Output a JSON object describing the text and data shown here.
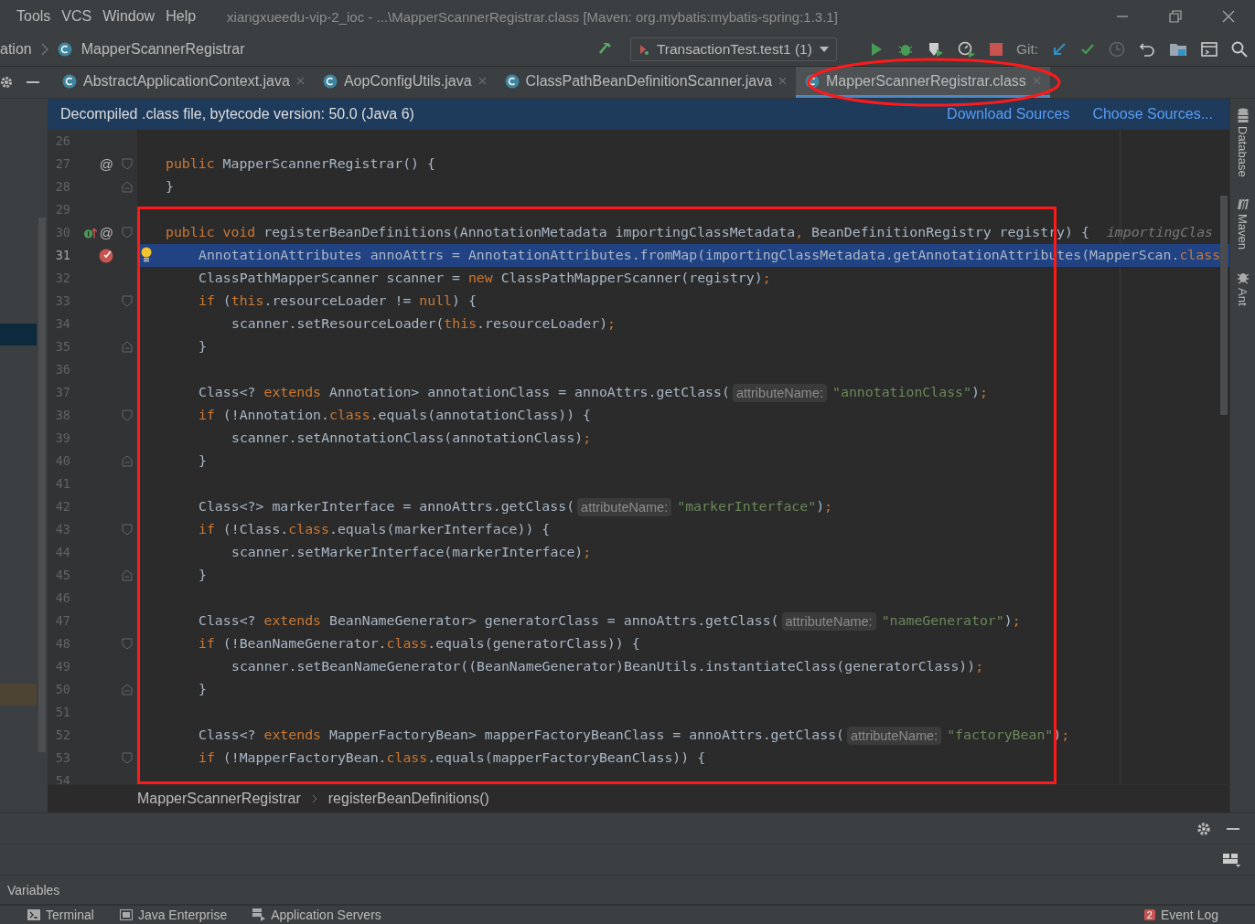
{
  "menu": [
    {
      "label": "Tools"
    },
    {
      "label": "VCS"
    },
    {
      "label": "Window"
    },
    {
      "label": "Help"
    }
  ],
  "window": {
    "title": "xiangxueedu-vip-2_ioc - ...\\MapperScannerRegistrar.class [Maven: org.mybatis:mybatis-spring:1.3.1]"
  },
  "navigation": {
    "crumbs": [
      "ation",
      "MapperScannerRegistrar"
    ],
    "run_config": "TransactionTest.test1 (1)",
    "git_label": "Git:"
  },
  "tabs": [
    {
      "label": "AbstractApplicationContext.java",
      "selected": false
    },
    {
      "label": "AopConfigUtils.java",
      "selected": false
    },
    {
      "label": "ClassPathBeanDefinitionScanner.java",
      "selected": false
    },
    {
      "label": "MapperScannerRegistrar.class",
      "selected": true
    }
  ],
  "banner": {
    "text": "Decompiled .class file, bytecode version: 50.0 (Java 6)",
    "links": [
      "Download Sources",
      "Choose Sources..."
    ]
  },
  "lines": [
    {
      "num": "26",
      "selected": false,
      "kind": "member"
    },
    {
      "num": "27",
      "selected": false,
      "kind": "member",
      "gutter": [
        {
          "kind": "at",
          "text": "@"
        },
        {
          "kind": "fold_start"
        }
      ],
      "tokens": [
        {
          "t": "public",
          "kind": "keyword"
        },
        {
          "t": " MapperScannerRegistrar() {",
          "kind": "plain"
        }
      ]
    },
    {
      "num": "28",
      "selected": false,
      "kind": "member",
      "gutter": [
        {
          "kind": "fold_end"
        }
      ],
      "tokens": [
        {
          "t": "}",
          "kind": "plain"
        }
      ]
    },
    {
      "num": "29",
      "selected": false,
      "kind": "member"
    },
    {
      "num": "30",
      "selected": false,
      "kind": "member",
      "gutter": [
        {
          "kind": "override"
        },
        {
          "kind": "at",
          "text": "@"
        },
        {
          "kind": "fold_start"
        }
      ],
      "tokens": [
        {
          "t": "public void",
          "kind": "keyword"
        },
        {
          "t": " registerBeanDefinitions(AnnotationMetadata importingClassMetadata",
          "kind": "plain"
        },
        {
          "t": ",",
          "kind": "keyword"
        },
        {
          "t": " BeanDefinitionRegistry registry) {",
          "kind": "plain"
        },
        {
          "t": "importingClas",
          "kind": "inlay"
        }
      ]
    },
    {
      "num": "31",
      "selected": true,
      "kind": "statement",
      "bulb": true,
      "gutter": [
        {
          "kind": "breakpoint"
        }
      ],
      "tokens": [
        {
          "t": "AnnotationAttributes annoAttrs = AnnotationAttributes.fromMap(importingClassMetadata.getAnnotationAttributes(MapperScan.",
          "kind": "plain"
        },
        {
          "t": "class",
          "kind": "keyword"
        }
      ]
    },
    {
      "num": "32",
      "selected": false,
      "kind": "statement",
      "tokens": [
        {
          "t": "ClassPathMapperScanner scanner = ",
          "kind": "plain"
        },
        {
          "t": "new",
          "kind": "keyword"
        },
        {
          "t": " ClassPathMapperScanner(registry)",
          "kind": "plain"
        },
        {
          "t": ";",
          "kind": "keyword"
        }
      ]
    },
    {
      "num": "33",
      "selected": false,
      "kind": "statement",
      "gutter": [
        {
          "kind": "fold_start"
        }
      ],
      "tokens": [
        {
          "t": "if",
          "kind": "keyword"
        },
        {
          "t": " (",
          "kind": "plain"
        },
        {
          "t": "this",
          "kind": "keyword"
        },
        {
          "t": ".resourceLoader != ",
          "kind": "plain"
        },
        {
          "t": "null",
          "kind": "keyword"
        },
        {
          "t": ") {",
          "kind": "plain"
        }
      ]
    },
    {
      "num": "34",
      "selected": false,
      "kind": "nested",
      "tokens": [
        {
          "t": "scanner.setResourceLoader(",
          "kind": "plain"
        },
        {
          "t": "this",
          "kind": "keyword"
        },
        {
          "t": ".resourceLoader)",
          "kind": "plain"
        },
        {
          "t": ";",
          "kind": "keyword"
        }
      ]
    },
    {
      "num": "35",
      "selected": false,
      "kind": "statement",
      "gutter": [
        {
          "kind": "fold_end"
        }
      ],
      "tokens": [
        {
          "t": "}",
          "kind": "plain"
        }
      ]
    },
    {
      "num": "36",
      "selected": false,
      "kind": "statement"
    },
    {
      "num": "37",
      "selected": false,
      "kind": "statement",
      "tokens": [
        {
          "t": "Class<? ",
          "kind": "plain"
        },
        {
          "t": "extends",
          "kind": "keyword"
        },
        {
          "t": " Annotation> annotationClass = annoAttrs.getClass(",
          "kind": "plain"
        },
        {
          "t": "attributeName:",
          "kind": "param"
        },
        {
          "t": "\"annotationClass\"",
          "kind": "string"
        },
        {
          "t": ")",
          "kind": "plain"
        },
        {
          "t": ";",
          "kind": "keyword"
        }
      ]
    },
    {
      "num": "38",
      "selected": false,
      "kind": "statement",
      "gutter": [
        {
          "kind": "fold_start"
        }
      ],
      "tokens": [
        {
          "t": "if",
          "kind": "keyword"
        },
        {
          "t": " (!Annotation.",
          "kind": "plain"
        },
        {
          "t": "class",
          "kind": "keyword"
        },
        {
          "t": ".equals(annotationClass)) {",
          "kind": "plain"
        }
      ]
    },
    {
      "num": "39",
      "selected": false,
      "kind": "nested",
      "tokens": [
        {
          "t": "scanner.setAnnotationClass(annotationClass)",
          "kind": "plain"
        },
        {
          "t": ";",
          "kind": "keyword"
        }
      ]
    },
    {
      "num": "40",
      "selected": false,
      "kind": "statement",
      "gutter": [
        {
          "kind": "fold_end"
        }
      ],
      "tokens": [
        {
          "t": "}",
          "kind": "plain"
        }
      ]
    },
    {
      "num": "41",
      "selected": false,
      "kind": "statement"
    },
    {
      "num": "42",
      "selected": false,
      "kind": "statement",
      "tokens": [
        {
          "t": "Class<?> markerInterface = annoAttrs.getClass(",
          "kind": "plain"
        },
        {
          "t": "attributeName:",
          "kind": "param"
        },
        {
          "t": "\"markerInterface\"",
          "kind": "string"
        },
        {
          "t": ")",
          "kind": "plain"
        },
        {
          "t": ";",
          "kind": "keyword"
        }
      ]
    },
    {
      "num": "43",
      "selected": false,
      "kind": "statement",
      "gutter": [
        {
          "kind": "fold_start"
        }
      ],
      "tokens": [
        {
          "t": "if",
          "kind": "keyword"
        },
        {
          "t": " (!Class.",
          "kind": "plain"
        },
        {
          "t": "class",
          "kind": "keyword"
        },
        {
          "t": ".equals(markerInterface)) {",
          "kind": "plain"
        }
      ]
    },
    {
      "num": "44",
      "selected": false,
      "kind": "nested",
      "tokens": [
        {
          "t": "scanner.setMarkerInterface(markerInterface)",
          "kind": "plain"
        },
        {
          "t": ";",
          "kind": "keyword"
        }
      ]
    },
    {
      "num": "45",
      "selected": false,
      "kind": "statement",
      "gutter": [
        {
          "kind": "fold_end"
        }
      ],
      "tokens": [
        {
          "t": "}",
          "kind": "plain"
        }
      ]
    },
    {
      "num": "46",
      "selected": false,
      "kind": "statement"
    },
    {
      "num": "47",
      "selected": false,
      "kind": "statement",
      "tokens": [
        {
          "t": "Class<? ",
          "kind": "plain"
        },
        {
          "t": "extends",
          "kind": "keyword"
        },
        {
          "t": " BeanNameGenerator> generatorClass = annoAttrs.getClass(",
          "kind": "plain"
        },
        {
          "t": "attributeName:",
          "kind": "param"
        },
        {
          "t": "\"nameGenerator\"",
          "kind": "string"
        },
        {
          "t": ")",
          "kind": "plain"
        },
        {
          "t": ";",
          "kind": "keyword"
        }
      ]
    },
    {
      "num": "48",
      "selected": false,
      "kind": "statement",
      "gutter": [
        {
          "kind": "fold_start"
        }
      ],
      "tokens": [
        {
          "t": "if",
          "kind": "keyword"
        },
        {
          "t": " (!BeanNameGenerator.",
          "kind": "plain"
        },
        {
          "t": "class",
          "kind": "keyword"
        },
        {
          "t": ".equals(generatorClass)) {",
          "kind": "plain"
        }
      ]
    },
    {
      "num": "49",
      "selected": false,
      "kind": "nested",
      "tokens": [
        {
          "t": "scanner.setBeanNameGenerator((BeanNameGenerator)BeanUtils.instantiateClass(generatorClass))",
          "kind": "plain"
        },
        {
          "t": ";",
          "kind": "keyword"
        }
      ]
    },
    {
      "num": "50",
      "selected": false,
      "kind": "statement",
      "gutter": [
        {
          "kind": "fold_end"
        }
      ],
      "tokens": [
        {
          "t": "}",
          "kind": "plain"
        }
      ]
    },
    {
      "num": "51",
      "selected": false,
      "kind": "statement"
    },
    {
      "num": "52",
      "selected": false,
      "kind": "statement",
      "tokens": [
        {
          "t": "Class<? ",
          "kind": "plain"
        },
        {
          "t": "extends",
          "kind": "keyword"
        },
        {
          "t": " MapperFactoryBean> mapperFactoryBeanClass = annoAttrs.getClass(",
          "kind": "plain"
        },
        {
          "t": "attributeName:",
          "kind": "param"
        },
        {
          "t": "\"factoryBean\"",
          "kind": "string"
        },
        {
          "t": ")",
          "kind": "plain"
        },
        {
          "t": ";",
          "kind": "keyword"
        }
      ]
    },
    {
      "num": "53",
      "selected": false,
      "kind": "statement",
      "gutter": [
        {
          "kind": "fold_start"
        }
      ],
      "tokens": [
        {
          "t": "if",
          "kind": "keyword"
        },
        {
          "t": " (!MapperFactoryBean.",
          "kind": "plain"
        },
        {
          "t": "class",
          "kind": "keyword"
        },
        {
          "t": ".equals(mapperFactoryBeanClass)) {",
          "kind": "plain"
        }
      ]
    },
    {
      "num": "54",
      "selected": false,
      "kind": "member"
    }
  ],
  "breadcrumbs": [
    "MapperScannerRegistrar",
    "registerBeanDefinitions()"
  ],
  "right_tools": [
    "Database",
    "Maven",
    "Ant"
  ],
  "debug_panel": {
    "tab": "Variables"
  },
  "status_bar": {
    "items": [
      {
        "label": "Terminal",
        "kind": "terminal"
      },
      {
        "label": "Java Enterprise",
        "kind": "enterprise"
      },
      {
        "label": "Application Servers",
        "kind": "servers"
      }
    ],
    "event_log": {
      "label": "Event Log",
      "count": "2"
    }
  }
}
